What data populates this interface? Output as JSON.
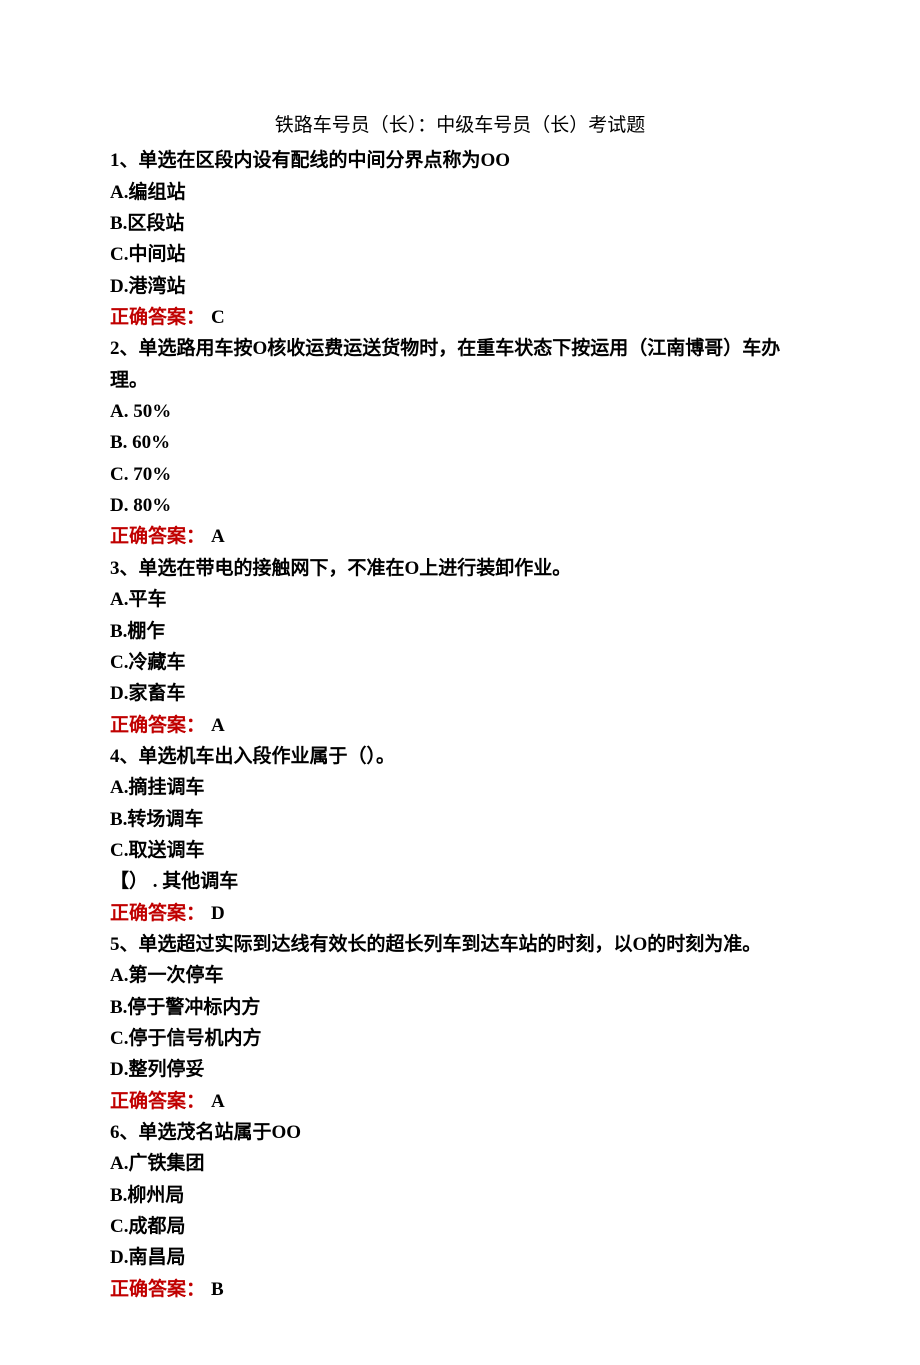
{
  "title": "铁路车号员（长）：中级车号员（长）考试题",
  "answer_label": "正确答案：",
  "questions": [
    {
      "num": "1",
      "text": "、单选在区段内设有配线的中间分界点称为OO",
      "options": [
        "A.编组站",
        "B.区段站",
        "C.中间站",
        "D.港湾站"
      ],
      "answer": "C"
    },
    {
      "num": "2",
      "text": "、单选路用车按O核收运费运送货物时，在重车状态下按运用（江南博哥）车办理。",
      "options": [
        "A.   50%",
        "B.   60%",
        "C.   70%",
        "D.   80%"
      ],
      "answer": "A"
    },
    {
      "num": "3",
      "text": "、单选在带电的接触网下，不准在O上进行装卸作业。",
      "options": [
        "A.平车",
        "B.棚乍",
        "C.冷藏车",
        "D.家畜车"
      ],
      "answer": "A"
    },
    {
      "num": "4",
      "text": "、单选机车出入段作业属于（）。",
      "options": [
        "A.摘挂调车",
        "B.转场调车",
        "C.取送调车",
        "【） . 其他调车"
      ],
      "answer": "D"
    },
    {
      "num": "5",
      "text": "、单选超过实际到达线有效长的超长列车到达车站的时刻，以O的时刻为准。",
      "options": [
        "A.第一次停车",
        "B.停于警冲标内方",
        "C.停于信号机内方",
        "D.整列停妥"
      ],
      "answer": "A"
    },
    {
      "num": "6",
      "text": "、单选茂名站属于OO",
      "options": [
        "A.广铁集团",
        "B.柳州局",
        "C.成都局",
        "D.南昌局"
      ],
      "answer": "B"
    }
  ]
}
